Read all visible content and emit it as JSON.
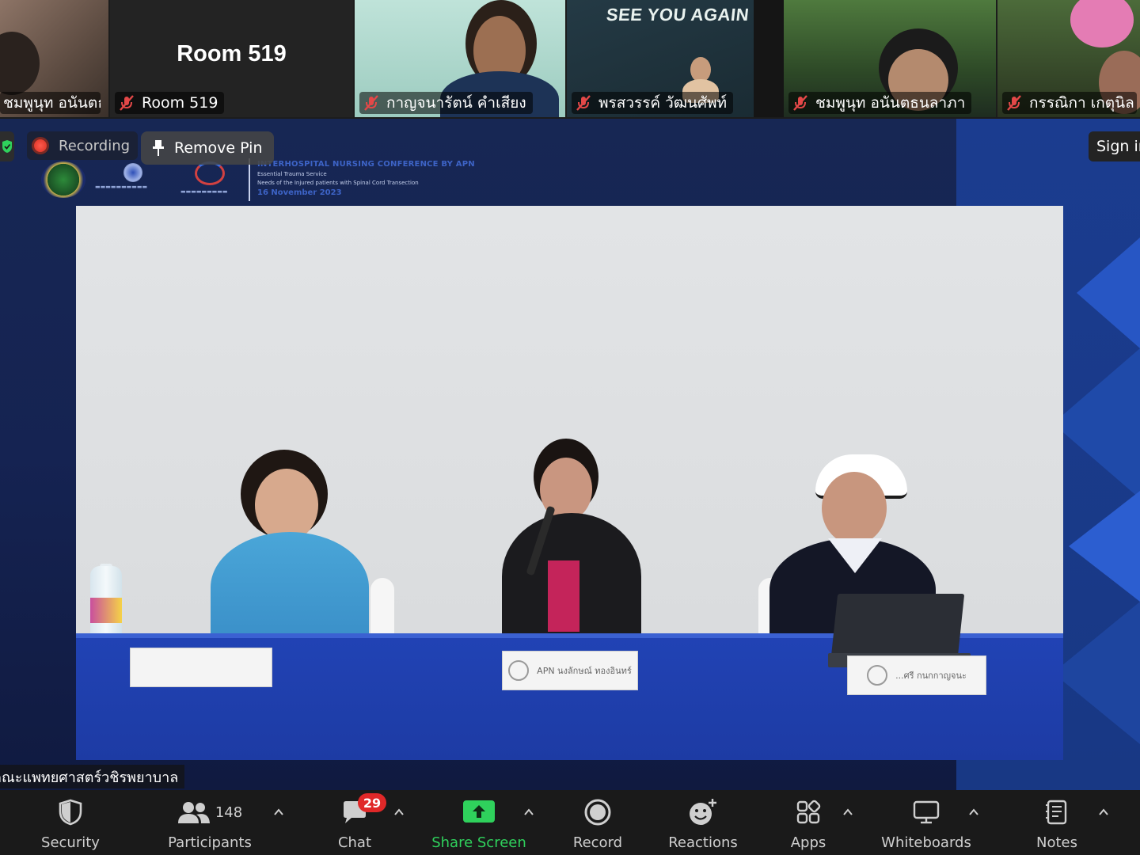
{
  "gallery": {
    "tiles": [
      {
        "name": "ชมพูนุท อนันตธนลาภา"
      },
      {
        "name": "Room 519",
        "display_title": "Room 519"
      },
      {
        "name": "กาญจนารัตน์ คำเสียง"
      },
      {
        "name": "พรสวรรค์ วัฒนศัพท์",
        "backdrop_text": "SEE YOU AGAIN"
      },
      {
        "name": "ชมพูนุท อนันตธนลาภา"
      },
      {
        "name": "กรรณิกา เกตุนิล"
      }
    ]
  },
  "overlay": {
    "recording_label": "Recording",
    "remove_pin_label": "Remove Pin",
    "sign_in_label": "Sign in"
  },
  "banner": {
    "title": "INTERHOSPITAL NURSING CONFERENCE BY APN",
    "line1": "Essential Trauma Service",
    "line2": "Needs of the Injured patients with Spinal Cord Transection",
    "date": "16 November 2023"
  },
  "video": {
    "nameplates": [
      "",
      "APN นงลักษณ์ ทองอินทร์",
      "...ศรี กนกกาญจนะ"
    ]
  },
  "caption": {
    "text": "คณะแพทยศาสตร์วชิรพยาบาล"
  },
  "toolbar": {
    "security": "Security",
    "participants": "Participants",
    "participants_count": "148",
    "chat": "Chat",
    "chat_badge": "29",
    "share_screen": "Share Screen",
    "record": "Record",
    "reactions": "Reactions",
    "apps": "Apps",
    "whiteboards": "Whiteboards",
    "notes": "Notes"
  },
  "colors": {
    "share_green": "#2fd15c",
    "badge_red": "#e02828",
    "stage_navy": "#152352",
    "accent_blue": "#1d3ba4"
  },
  "icons": [
    "muted-mic-icon",
    "shield-icon",
    "participants-icon",
    "chat-icon",
    "share-screen-icon",
    "record-icon",
    "reactions-icon",
    "apps-icon",
    "whiteboard-icon",
    "notes-icon",
    "pin-icon",
    "chevron-up-icon"
  ]
}
